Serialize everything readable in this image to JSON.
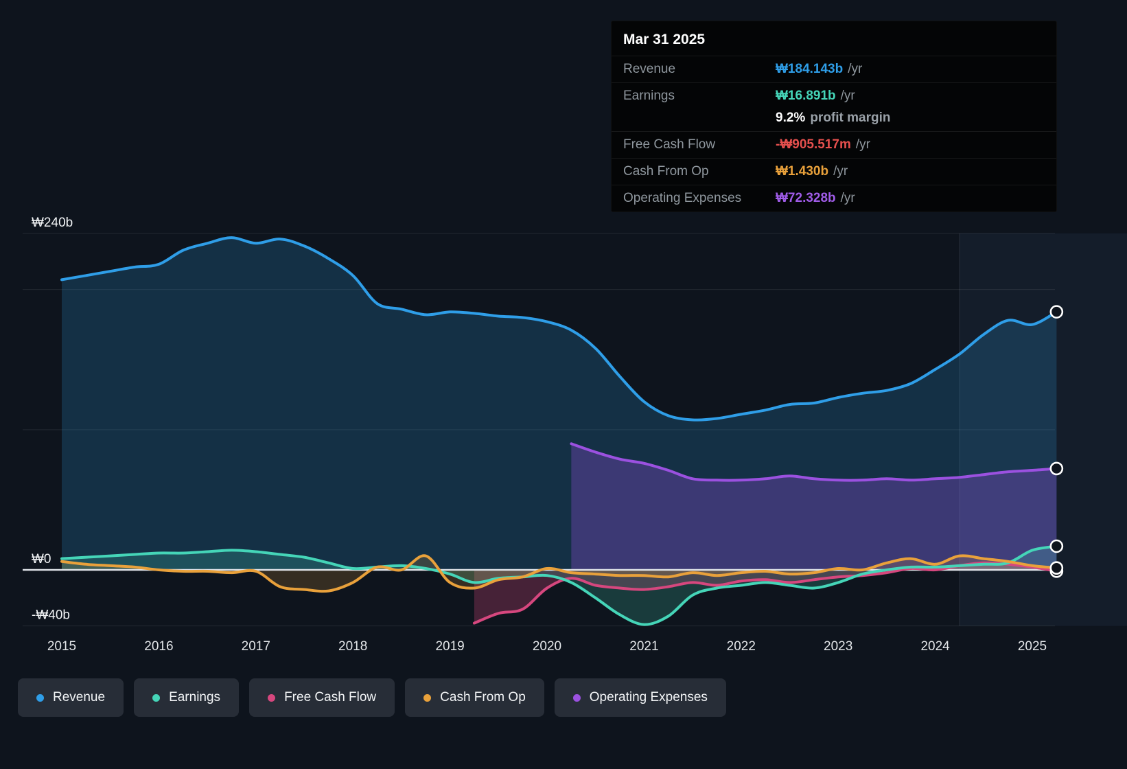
{
  "tooltip": {
    "title": "Mar 31 2025",
    "per_year_suffix": "/yr",
    "rows": [
      {
        "name": "revenue",
        "label": "Revenue",
        "value": "₩184.143b",
        "suffix": "/yr",
        "color": "#2f9ee8",
        "margin_row": false
      },
      {
        "name": "earnings",
        "label": "Earnings",
        "value": "₩16.891b",
        "suffix": "/yr",
        "color": "#45d5b8",
        "margin_row": false
      },
      {
        "name": "profit-margin",
        "label": "",
        "value": "9.2%",
        "suffix": "profit margin",
        "color": "#ffffff",
        "margin_row": true
      },
      {
        "name": "free-cash-flow",
        "label": "Free Cash Flow",
        "value": "-₩905.517m",
        "suffix": "/yr",
        "color": "#e6504e",
        "margin_row": false
      },
      {
        "name": "cash-from-op",
        "label": "Cash From Op",
        "value": "₩1.430b",
        "suffix": "/yr",
        "color": "#e9a13b",
        "margin_row": false
      },
      {
        "name": "operating-expenses",
        "label": "Operating Expenses",
        "value": "₩72.328b",
        "suffix": "/yr",
        "color": "#a05ce8",
        "margin_row": false
      }
    ]
  },
  "legend": {
    "items": [
      {
        "name": "revenue",
        "label": "Revenue",
        "color": "#2f9ee8"
      },
      {
        "name": "earnings",
        "label": "Earnings",
        "color": "#45d5b8"
      },
      {
        "name": "free-cash-flow",
        "label": "Free Cash Flow",
        "color": "#d6477e"
      },
      {
        "name": "cash-from-op",
        "label": "Cash From Op",
        "color": "#e9a13b"
      },
      {
        "name": "operating-expenses",
        "label": "Operating Expenses",
        "color": "#9b51e0"
      }
    ]
  },
  "chart_data": {
    "type": "line",
    "title": "",
    "units": "billions KRW (₩b)",
    "x_ticks": [
      2015,
      2016,
      2017,
      2018,
      2019,
      2020,
      2021,
      2022,
      2023,
      2024,
      2025
    ],
    "ylim": [
      -55,
      262
    ],
    "gridlines": [
      240,
      200,
      100,
      0,
      -40
    ],
    "y_axis_labels": [
      {
        "value": 240,
        "label": "₩240b"
      },
      {
        "value": 0,
        "label": "₩0"
      },
      {
        "value": -40,
        "label": "-₩40b"
      }
    ],
    "zero_line_value": 0,
    "highlight_start_x": 2024.25,
    "legend_position": "bottom",
    "series": [
      {
        "name": "Revenue",
        "color": "#2f9ee8",
        "fill_opacity": 0.2,
        "x0": 2015.0,
        "dx": 0.25,
        "values": [
          207,
          210,
          213,
          216,
          218,
          228,
          233,
          237,
          233,
          236,
          231,
          222,
          210,
          190,
          186,
          182,
          184,
          183,
          181,
          180,
          177,
          171,
          158,
          138,
          120,
          110,
          107,
          108,
          111,
          114,
          118,
          119,
          123,
          126,
          128,
          133,
          143,
          154,
          168,
          178,
          175,
          184.1
        ]
      },
      {
        "name": "Operating Expenses",
        "color": "#9b51e0",
        "fill_opacity": 0.3,
        "x0": 2020.25,
        "dx": 0.25,
        "values": [
          90,
          84,
          79,
          76,
          71,
          65,
          64,
          64,
          65,
          67,
          65,
          64,
          64,
          65,
          64,
          65,
          66,
          68,
          70,
          71,
          72.3
        ]
      },
      {
        "name": "Free Cash Flow",
        "color": "#d6477e",
        "fill_opacity": 0.28,
        "x0": 2019.25,
        "dx": 0.25,
        "values": [
          -38,
          -31,
          -28,
          -13,
          -6,
          -11,
          -13,
          -14,
          -12,
          -9,
          -11,
          -8,
          -7,
          -9,
          -7,
          -5,
          -4,
          -2,
          1,
          0,
          3,
          5,
          4,
          2,
          -0.9
        ]
      },
      {
        "name": "Earnings",
        "color": "#45d5b8",
        "fill_opacity": 0.2,
        "x0": 2015.0,
        "dx": 0.25,
        "values": [
          8,
          9,
          10,
          11,
          12,
          12,
          13,
          14,
          13,
          11,
          9,
          5,
          1,
          2,
          3,
          1,
          -3,
          -9,
          -6,
          -5,
          -4,
          -9,
          -20,
          -32,
          -39,
          -33,
          -18,
          -13,
          -11,
          -9,
          -11,
          -13,
          -9,
          -3,
          0,
          2,
          2,
          3,
          4,
          5,
          14,
          16.9
        ]
      },
      {
        "name": "Cash From Op",
        "color": "#e9a13b",
        "fill_opacity": 0.18,
        "x0": 2015.0,
        "dx": 0.25,
        "values": [
          6,
          4,
          3,
          2,
          0,
          -1,
          -1,
          -2,
          -1,
          -12,
          -14,
          -15,
          -9,
          2,
          0,
          10,
          -9,
          -13,
          -7,
          -5,
          1,
          -2,
          -3,
          -4,
          -4,
          -5,
          -2,
          -4,
          -2,
          -1,
          -3,
          -2,
          1,
          0,
          5,
          8,
          4,
          10,
          8,
          6,
          3,
          1.4
        ]
      }
    ]
  }
}
